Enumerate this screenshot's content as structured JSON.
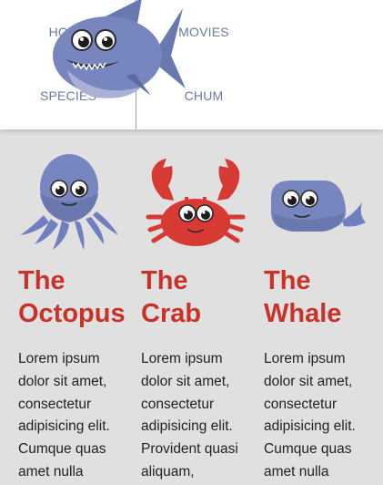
{
  "nav": {
    "home": "HOME",
    "movies": "MOVIES",
    "species": "SPECIES",
    "chum": "CHUM"
  },
  "logo": {
    "icon": "shark-logo-icon"
  },
  "creatures": [
    {
      "icon": "octopus-icon",
      "title_line1": "The",
      "title_line2": "Octopus",
      "text": "Lorem ipsum dolor sit amet, consectetur adipisicing elit. Cumque quas amet nulla"
    },
    {
      "icon": "crab-icon",
      "title_line1": "The",
      "title_line2": "Crab",
      "text": "Lorem ipsum dolor sit amet, consectetur adipisicing elit. Provident quasi aliquam,"
    },
    {
      "icon": "whale-icon",
      "title_line1": "The",
      "title_line2": "Whale",
      "text": "Lorem ipsum dolor sit amet, consectetur adipisicing elit. Cumque quas amet nulla"
    }
  ],
  "colors": {
    "title": "#c83228",
    "nav_text": "#6b7a9f",
    "background": "#e0e0e0",
    "creature_blue": "#6f7fbf",
    "crab_red": "#d63a32"
  }
}
